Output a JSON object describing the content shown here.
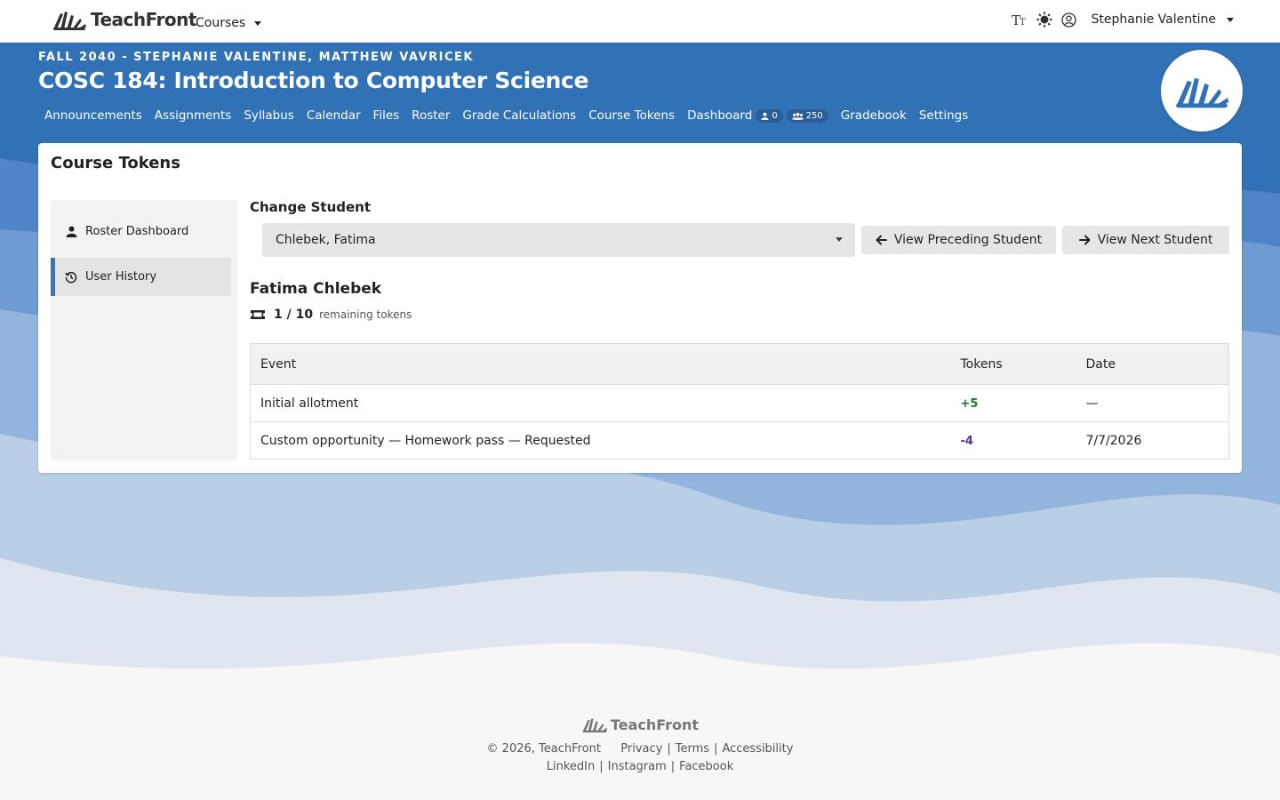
{
  "topbar": {
    "brand": "TeachFront",
    "courses_label": "Courses",
    "user_name": "Stephanie Valentine"
  },
  "header": {
    "term": "FALL 2040 - STEPHANIE VALENTINE, MATTHEW VAVRICEK",
    "title": "COSC 184: Introduction to Computer Science",
    "nav": {
      "announcements": "Announcements",
      "assignments": "Assignments",
      "syllabus": "Syllabus",
      "calendar": "Calendar",
      "files": "Files",
      "roster": "Roster",
      "grade_calculations": "Grade Calculations",
      "course_tokens": "Course Tokens",
      "dashboard": "Dashboard",
      "dashboard_user_count": "0",
      "dashboard_group_count": "250",
      "gradebook": "Gradebook",
      "settings": "Settings"
    }
  },
  "page": {
    "title": "Course Tokens",
    "sidenav": {
      "roster_dashboard": "Roster Dashboard",
      "user_history": "User History"
    },
    "change_student_label": "Change Student",
    "selected_student": "Chlebek, Fatima",
    "prev_button": "View Preceding Student",
    "next_button": "View Next Student",
    "student_name": "Fatima Chlebek",
    "tokens_count": "1 / 10",
    "tokens_label": "remaining tokens",
    "table": {
      "headers": {
        "event": "Event",
        "tokens": "Tokens",
        "date": "Date"
      },
      "rows": [
        {
          "event": "Initial allotment",
          "tokens": "+5",
          "date": "—"
        },
        {
          "event": "Custom opportunity — Homework pass — Requested",
          "tokens": "-4",
          "date": "7/7/2026"
        }
      ]
    }
  },
  "footer": {
    "brand": "TeachFront",
    "copyright": "© 2026, TeachFront",
    "privacy": "Privacy",
    "terms": "Terms",
    "accessibility": "Accessibility",
    "linkedin": "LinkedIn",
    "instagram": "Instagram",
    "facebook": "Facebook"
  },
  "colors": {
    "header_blue": "#3171b5",
    "active_accent": "#3b75b8",
    "positive": "#1a7a2b",
    "negative": "#5b2aa0"
  }
}
